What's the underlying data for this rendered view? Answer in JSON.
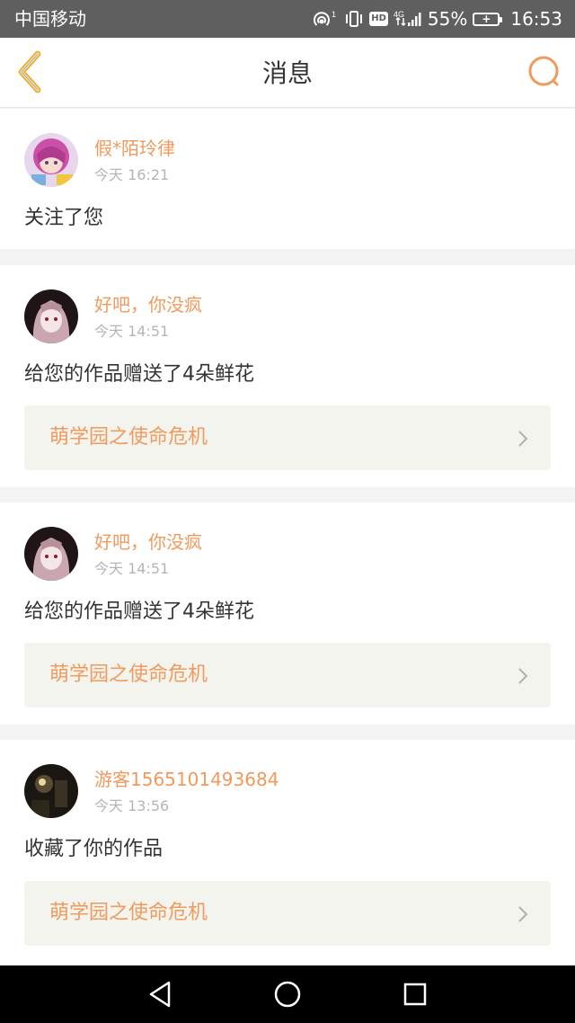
{
  "status_bar": {
    "carrier": "中国移动",
    "hotspot_count": "1",
    "hd": "HD",
    "network": "4G",
    "battery_percent": "55%",
    "time": "16:53",
    "background_color": "#5f5f5f"
  },
  "header": {
    "title": "消息",
    "back_icon": "chevron-left-icon",
    "search_icon": "search-icon",
    "accent_color": "#f09a5d"
  },
  "notifications": [
    {
      "username": "假*陌玲律",
      "time": "今天 16:21",
      "message": "关注了您",
      "avatar": "anime-avatar-colorful"
    },
    {
      "username": "好吧，你没疯",
      "time": "今天 14:51",
      "message": "给您的作品赠送了4朵鲜花",
      "work": "萌学园之使命危机",
      "avatar": "anime-avatar-dark"
    },
    {
      "username": "好吧，你没疯",
      "time": "今天 14:51",
      "message": "给您的作品赠送了4朵鲜花",
      "work": "萌学园之使命危机",
      "avatar": "anime-avatar-dark"
    },
    {
      "username": "游客1565101493684",
      "time": "今天 13:56",
      "message": "收藏了你的作品",
      "work": "萌学园之使命危机",
      "avatar": "photo-avatar-night"
    }
  ],
  "nav_bar": {
    "back": "triangle-back-icon",
    "home": "circle-home-icon",
    "recents": "square-recents-icon"
  }
}
